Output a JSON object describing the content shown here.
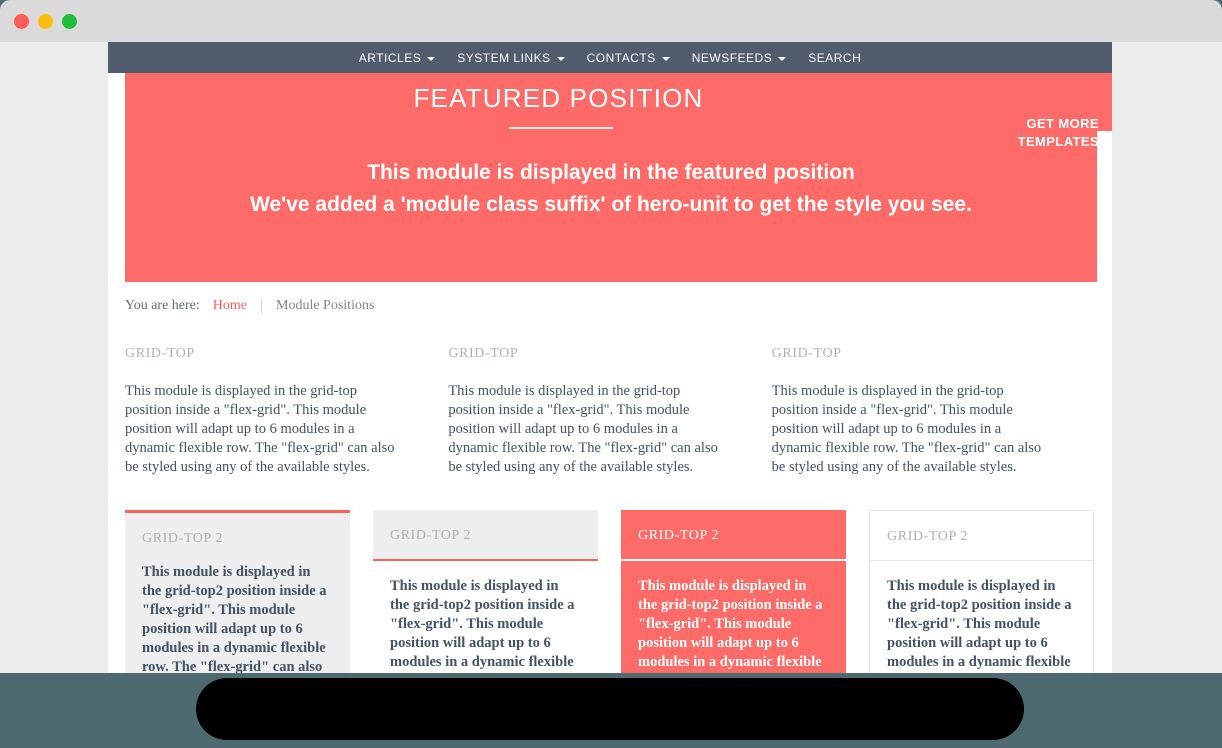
{
  "window": {
    "buttons": [
      {
        "name": "close",
        "color": "#fb5d57"
      },
      {
        "name": "minimize",
        "color": "#fdbc0f"
      },
      {
        "name": "maximize",
        "color": "#1ec03a"
      }
    ]
  },
  "theme": {
    "accent_red": "#fc6b67",
    "link_red": "#f8615c",
    "navbar": "#515d6e",
    "body_text": "#415364",
    "muted_text": "#a9b2b8",
    "page_bg": "#ececec",
    "chrome_bg": "#dadada",
    "bottom_bg": "#4c6a70",
    "card_grey": "#eeeeee"
  },
  "navbar": {
    "items": [
      {
        "label": "ARTICLES",
        "has_dropdown": true,
        "icon": "chevron-down-icon"
      },
      {
        "label": "SYSTEM LINKS",
        "has_dropdown": true,
        "icon": "chevron-down-icon"
      },
      {
        "label": "CONTACTS",
        "has_dropdown": true,
        "icon": "chevron-down-icon"
      },
      {
        "label": "NEWSFEEDS",
        "has_dropdown": true,
        "icon": "chevron-down-icon"
      },
      {
        "label": "SEARCH",
        "has_dropdown": false,
        "icon": ""
      }
    ]
  },
  "featured": {
    "title": "FEATURED POSITION",
    "cta_line1": "GET MORE",
    "cta_line2": "TEMPLATES",
    "hero_line1": "This module is displayed in the featured position",
    "hero_line2": "We've added a 'module class suffix' of hero-unit to get the style you see."
  },
  "breadcrumb": {
    "label": "You are here:",
    "home": "Home",
    "current": "Module Positions"
  },
  "grid_top": {
    "columns": [
      {
        "heading": "GRID-TOP",
        "body": "This module is displayed in the grid-top position inside a \"flex-grid\". This module position will adapt up to 6 modules in a dynamic flexible row. The \"flex-grid\" can also be styled using any of the available styles."
      },
      {
        "heading": "GRID-TOP",
        "body": "This module is displayed in the grid-top position inside a \"flex-grid\". This module position will adapt up to 6 modules in a dynamic flexible row. The \"flex-grid\" can also be styled using any of the available styles."
      },
      {
        "heading": "GRID-TOP",
        "body": "This module is displayed in the grid-top position inside a \"flex-grid\". This module position will adapt up to 6 modules in a dynamic flexible row. The \"flex-grid\" can also be styled using any of the available styles."
      }
    ]
  },
  "grid_top_2": {
    "cards": [
      {
        "heading": "GRID-TOP 2",
        "body": "This module is displayed in the grid-top2 position inside a \"flex-grid\". This module position will adapt up to 6 modules in a dynamic flexible row. The \"flex-grid\" can also be styled using",
        "style": "grey-red-top"
      },
      {
        "heading": "GRID-TOP 2",
        "body": "This module is displayed in the grid-top2 position inside a \"flex-grid\". This module position will adapt up to 6 modules in a dynamic flexible row. The \"flex-",
        "style": "grey-head-red-underline"
      },
      {
        "heading": "GRID-TOP 2",
        "body": "This module is displayed in the grid-top2 position inside a \"flex-grid\". This module position will adapt up to 6 modules in a dynamic flexible row. The \"flex-",
        "style": "solid-red"
      },
      {
        "heading": "GRID-TOP 2",
        "body": "This module is displayed in the grid-top2 position inside a \"flex-grid\". This module position will adapt up to 6 modules in a dynamic flexible row. The \"flex-",
        "style": "white-bordered"
      }
    ]
  }
}
